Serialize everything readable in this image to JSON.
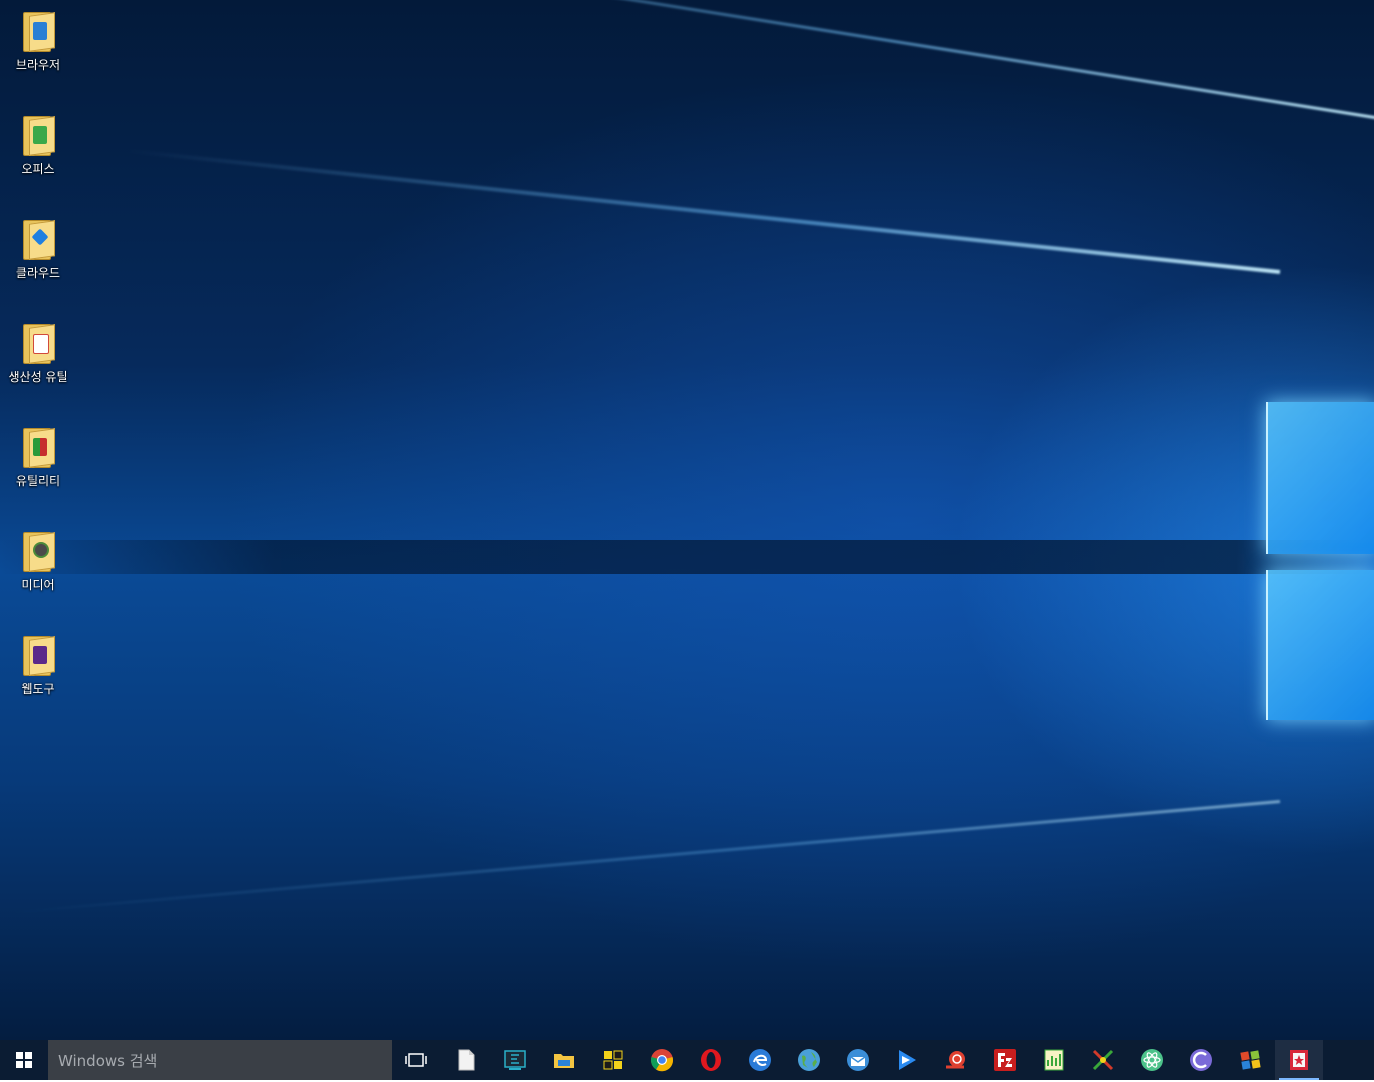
{
  "desktop": {
    "icons": [
      {
        "label": "브라우저",
        "badge_color": "#2a7fd4"
      },
      {
        "label": "오피스",
        "badge_color": "#3aa84a"
      },
      {
        "label": "클라우드",
        "badge_color": "#1f7fe0"
      },
      {
        "label": "생산성 유틸",
        "badge_color": "#d14a3a"
      },
      {
        "label": "유틸리티",
        "badge_color": "#c62d2d"
      },
      {
        "label": "미디어",
        "badge_color": "#4a8a3a"
      },
      {
        "label": "웹도구",
        "badge_color": "#5a2a8a"
      }
    ]
  },
  "taskbar": {
    "search": {
      "placeholder": "Windows 검색"
    },
    "accent_color": "#7db8ff",
    "pinned": [
      {
        "icon": "task-view-icon",
        "color": "#ffffff"
      },
      {
        "icon": "document-icon",
        "color": "#f2f2f2"
      },
      {
        "icon": "editor-icon",
        "color": "#2ab0c8"
      },
      {
        "icon": "file-explorer-icon",
        "color": "#f4c542"
      },
      {
        "icon": "puzzle-app-icon",
        "color": "#f2d21b"
      },
      {
        "icon": "chrome-icon",
        "color": "#db4437"
      },
      {
        "icon": "opera-icon",
        "color": "#e0181f"
      },
      {
        "icon": "browser-blue-icon",
        "color": "#2a7bd8"
      },
      {
        "icon": "globe-icon",
        "color": "#5aae4a"
      },
      {
        "icon": "mail-client-icon",
        "color": "#3b8ed8"
      },
      {
        "icon": "media-player-icon",
        "color": "#2a8af0"
      },
      {
        "icon": "snail-icon",
        "color": "#e04030"
      },
      {
        "icon": "filezilla-icon",
        "color": "#c81e1e"
      },
      {
        "icon": "notepad-chart-icon",
        "color": "#3aa83a"
      },
      {
        "icon": "network-tool-icon",
        "color": "#d23a2a"
      },
      {
        "icon": "atom-icon",
        "color": "#4cc28a"
      },
      {
        "icon": "torrent-icon",
        "color": "#7a6ad8"
      },
      {
        "icon": "windows-tool-icon",
        "color": "#8ac43a"
      },
      {
        "icon": "bookmark-app-icon",
        "color": "#d8283a"
      }
    ]
  }
}
